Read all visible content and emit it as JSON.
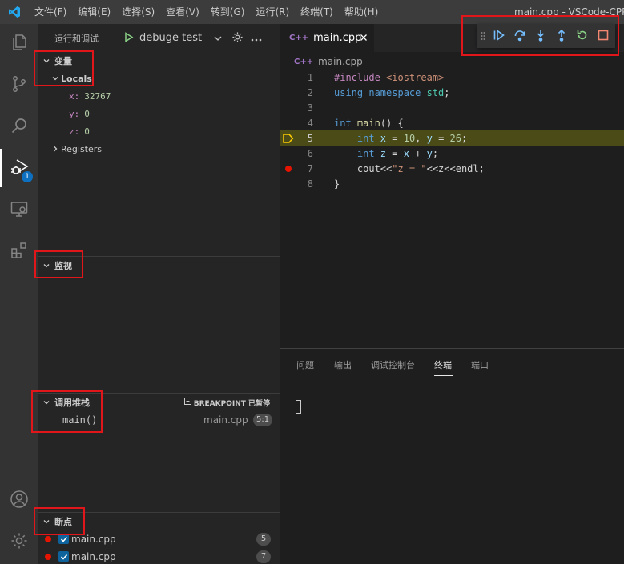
{
  "window_title": "main.cpp - VSCode-CPP [Ubuntu]",
  "menu": [
    "文件(F)",
    "编辑(E)",
    "选择(S)",
    "查看(V)",
    "转到(G)",
    "运行(R)",
    "终端(T)",
    "帮助(H)"
  ],
  "activity_bar": {
    "debug_badge": "1"
  },
  "sidebar": {
    "title": "运行和调试",
    "config_name": "debuge test",
    "variables": {
      "header": "变量",
      "locals_label": "Locals",
      "items": [
        {
          "name": "x:",
          "value": "32767"
        },
        {
          "name": "y:",
          "value": "0"
        },
        {
          "name": "z:",
          "value": "0"
        }
      ],
      "registers_label": "Registers"
    },
    "watch": {
      "header": "监视"
    },
    "call_stack": {
      "header": "调用堆栈",
      "status": "BREAKPOINT 已暂停",
      "frame_name": "main()",
      "frame_file": "main.cpp",
      "frame_pos": "5:1"
    },
    "breakpoints": {
      "header": "断点",
      "items": [
        {
          "file": "main.cpp",
          "line": "5"
        },
        {
          "file": "main.cpp",
          "line": "7"
        }
      ]
    }
  },
  "editor": {
    "tab_label": "main.cpp",
    "breadcrumb": "main.cpp",
    "line_numbers": [
      "1",
      "2",
      "3",
      "4",
      "5",
      "6",
      "7",
      "8"
    ],
    "code": {
      "l1_a": "#include ",
      "l1_b": "<iostream>",
      "l2_a": "using ",
      "l2_b": "namespace ",
      "l2_c": "std",
      "l2_d": ";",
      "l4_a": "int ",
      "l4_b": "main",
      "l4_c": "() {",
      "l5_a": "    int ",
      "l5_b": "x",
      "l5_c": " = ",
      "l5_d": "10",
      "l5_e": ", ",
      "l5_f": "y",
      "l5_g": " = ",
      "l5_h": "26",
      "l5_i": ";",
      "l6_a": "    int ",
      "l6_b": "z",
      "l6_c": " = ",
      "l6_d": "x",
      "l6_e": " + ",
      "l6_f": "y",
      "l6_g": ";",
      "l7_a": "    cout<<",
      "l7_b": "\"z = \"",
      "l7_c": "<<z<<endl;",
      "l8_a": "}"
    }
  },
  "panel": {
    "tabs": [
      "问题",
      "输出",
      "调试控制台",
      "终端",
      "端口"
    ],
    "active_tab": "终端"
  },
  "colors": {
    "accent": "#0e70c0",
    "breakpoint": "#e51400",
    "annotation": "#e0161b",
    "current_line": "#4b4b18"
  }
}
